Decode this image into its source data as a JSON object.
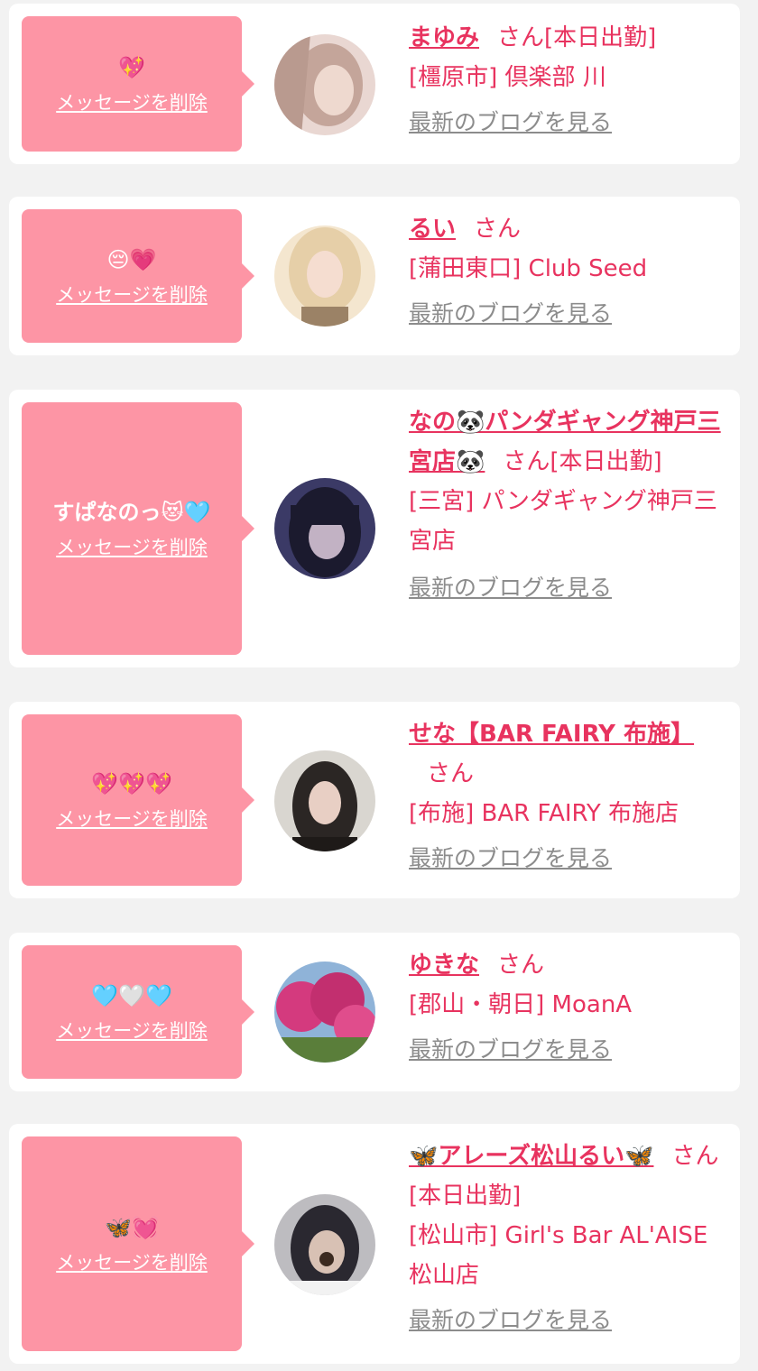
{
  "delete_label": "メッセージを削除",
  "blog_label": "最新のブログを見る",
  "suffix": "さん",
  "entries": [
    {
      "message": "💖",
      "name": "まゆみ",
      "status": "[本日出勤]",
      "shop": "[橿原市] 倶楽部 川",
      "avatar_colors": [
        "#e9d7d2",
        "#c4a59a",
        "#8b6d63"
      ]
    },
    {
      "message": "😔💗",
      "name": "るい",
      "status": "",
      "shop": "[蒲田東口] Club Seed",
      "avatar_colors": [
        "#f4e6cf",
        "#e2c9a3",
        "#9b8266"
      ]
    },
    {
      "message": "すぱなのっ😻🩵",
      "name": "なの🐼パンダギャング神戸三宮店🐼",
      "status": "[本日出勤]",
      "shop": "[三宮] パンダギャング神戸三宮店",
      "avatar_colors": [
        "#3b3a66",
        "#1b1a2e",
        "#c2b2c4"
      ]
    },
    {
      "message": "💖💖💖",
      "name": "せな【BAR FAIRY 布施】",
      "status": "",
      "shop": "[布施] BAR FAIRY 布施店",
      "avatar_colors": [
        "#d9d6d0",
        "#2b2624",
        "#e8cfc4"
      ]
    },
    {
      "message": "🩵🤍🩵",
      "name": "ゆきな",
      "status": "",
      "shop": "[郡山・朝日] MoanA",
      "avatar_colors": [
        "#8fb3d8",
        "#d43a7e",
        "#5a7e3a"
      ]
    },
    {
      "message": "🦋💓",
      "name": "🦋アレーズ松山るい🦋",
      "status": "[本日出勤]",
      "shop": "[松山市] Girl's Bar AL'AISE 松山店",
      "avatar_colors": [
        "#bdbcc0",
        "#2a2830",
        "#d8c1b4"
      ]
    }
  ],
  "colors": {
    "background": "#f2f2f2",
    "card": "#ffffff",
    "bubble": "#fd95a5",
    "accent": "#e8335f",
    "link_gray": "#8c8c8c"
  }
}
